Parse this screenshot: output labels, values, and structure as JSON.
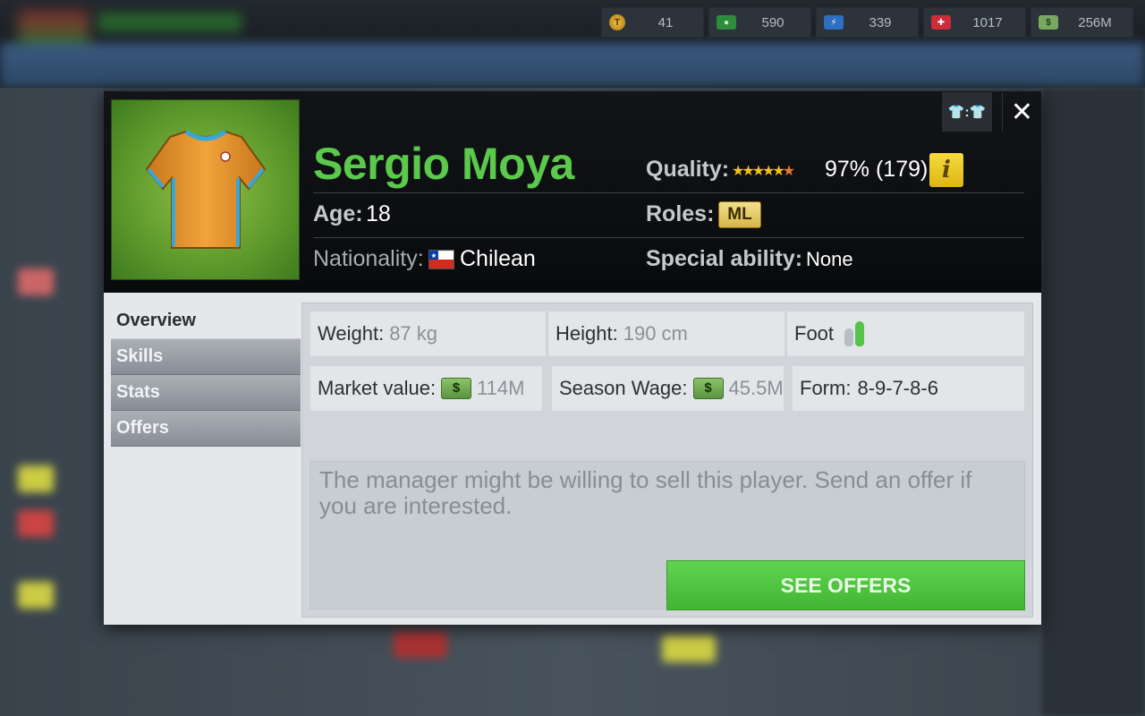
{
  "currencies": [
    {
      "icon": "token-coin-icon",
      "value": "41"
    },
    {
      "icon": "green-cash-icon",
      "value": "590"
    },
    {
      "icon": "energy-icon",
      "value": "339"
    },
    {
      "icon": "medical-icon",
      "value": "1017"
    },
    {
      "icon": "money-stack-icon",
      "value": "256M"
    }
  ],
  "player": {
    "name": "Sergio Moya",
    "age_label": "Age:",
    "age": "18",
    "nationality_label": "Nationality:",
    "nationality": "Chilean",
    "quality_label": "Quality:",
    "quality_stars": 4.5,
    "quality_value": "97% (179)",
    "roles_label": "Roles:",
    "role": "ML",
    "special_label": "Special ability:",
    "special": "None",
    "kit_color": "#e89a2e",
    "kit_trim": "#3aa6d8"
  },
  "header_buttons": {
    "info": "i",
    "kit_swap": "👕:👕",
    "close": "✕"
  },
  "nav": {
    "items": [
      "Overview",
      "Skills",
      "Stats",
      "Offers"
    ],
    "active": "Overview"
  },
  "overview": {
    "weight_label": "Weight:",
    "weight": "87 kg",
    "height_label": "Height:",
    "height": "190 cm",
    "foot_label": "Foot",
    "preferred_foot": "right",
    "market_label": "Market value:",
    "market_value": "114M",
    "wage_label": "Season Wage:",
    "wage": "45.5M",
    "form_label": "Form:",
    "form": "8-9-7-8-6",
    "message": "The manager might be willing to sell this player. Send an offer if you are interested.",
    "button": "SEE OFFERS"
  },
  "colors": {
    "name_green": "#5ac94c",
    "button_green": "#4fc43f",
    "header_bg": "#0c0e10"
  }
}
